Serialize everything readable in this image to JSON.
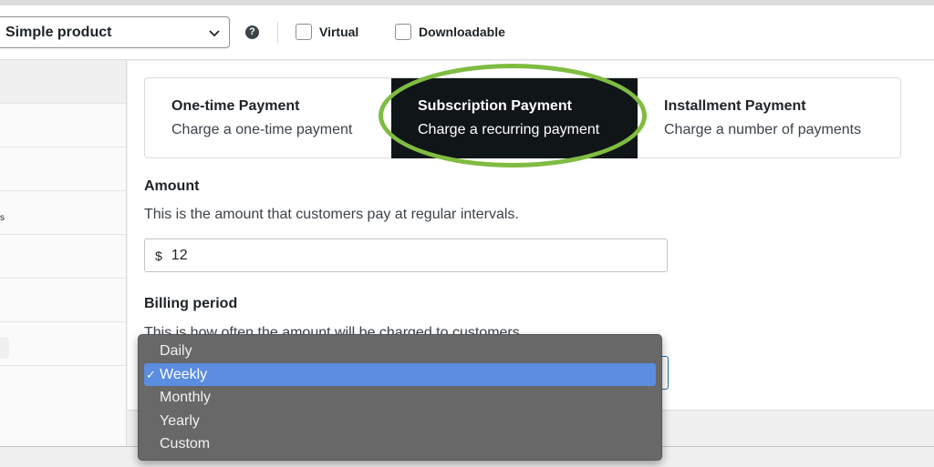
{
  "toolbar": {
    "product_type": "Simple product",
    "help_glyph": "?",
    "virtual_label": "Virtual",
    "downloadable_label": "Downloadable"
  },
  "sidebar": {
    "mark": "s"
  },
  "payment_types": [
    {
      "title": "One-time Payment",
      "description": "Charge a one-time payment",
      "selected": false
    },
    {
      "title": "Subscription Payment",
      "description": "Charge a recurring payment",
      "selected": true
    },
    {
      "title": "Installment Payment",
      "description": "Charge a number of payments",
      "selected": false
    }
  ],
  "amount": {
    "label": "Amount",
    "help": "This is the amount that customers pay at regular intervals.",
    "currency": "$",
    "value": "12"
  },
  "billing_period": {
    "label": "Billing period",
    "help": "This is how often the amount will be charged to customers.",
    "options": [
      "Daily",
      "Weekly",
      "Monthly",
      "Yearly",
      "Custom"
    ],
    "selected": "Weekly",
    "check_glyph": "✓"
  },
  "colors": {
    "highlight_ring": "#7fbc41",
    "selected_tab_bg": "#101517",
    "dropdown_bg": "#686868",
    "dropdown_selected": "#5b8de0",
    "focus_border": "#2271b1"
  }
}
